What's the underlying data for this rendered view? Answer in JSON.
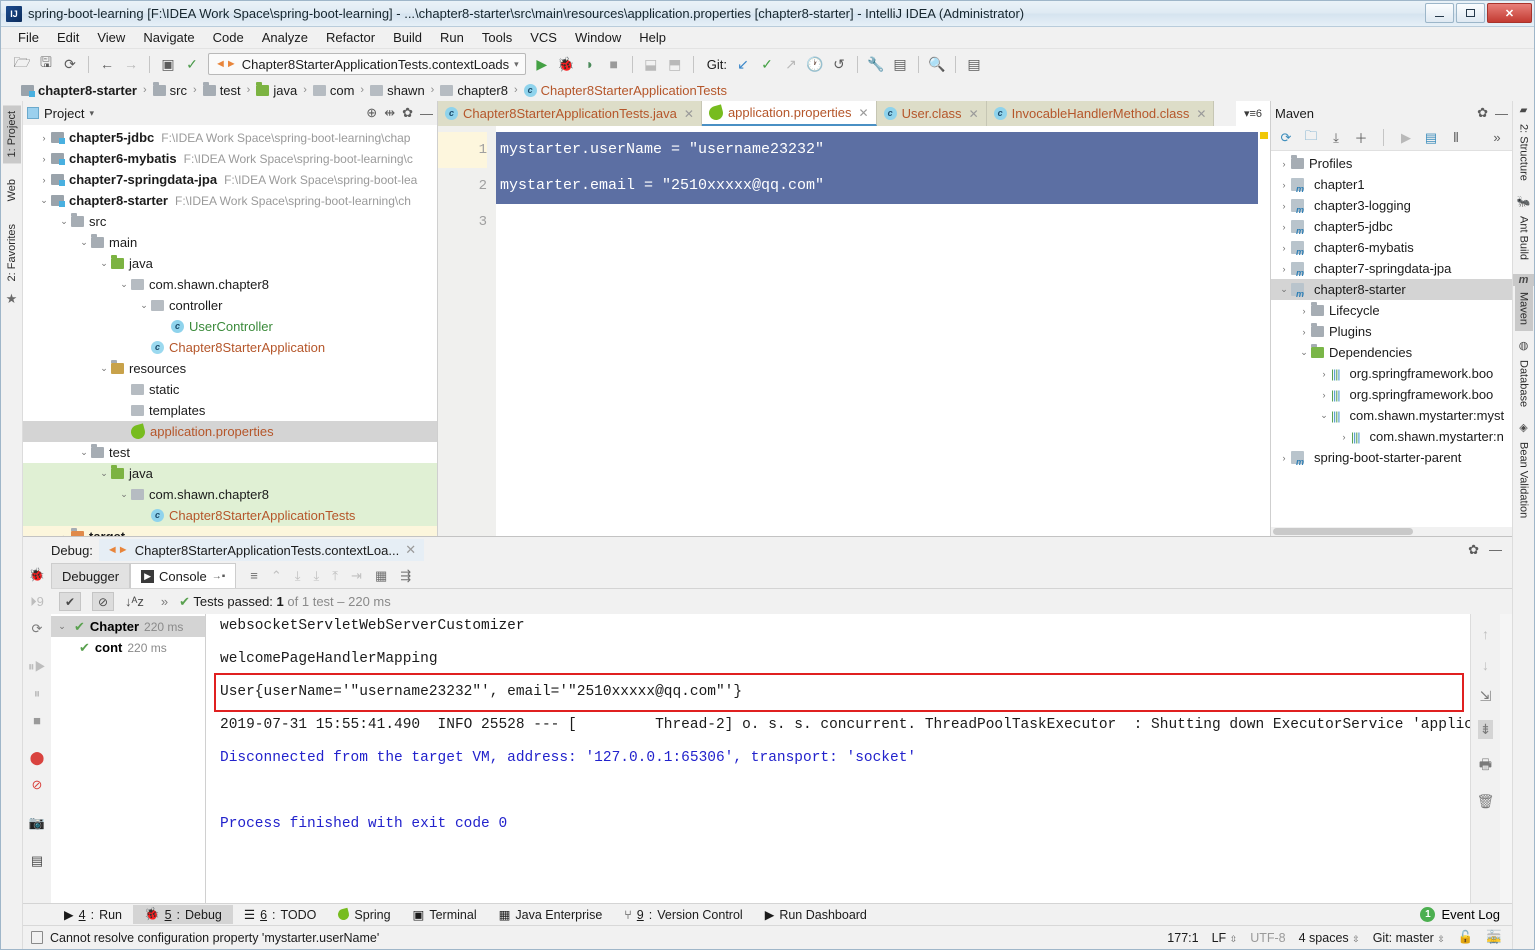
{
  "window": {
    "title": "spring-boot-learning [F:\\IDEA Work Space\\spring-boot-learning] - ...\\chapter8-starter\\src\\main\\resources\\application.properties [chapter8-starter] - IntelliJ IDEA (Administrator)",
    "logo": "IJ",
    "minimize_label": "minimize-icon",
    "maximize_label": "maximize-icon",
    "close_label": "✕"
  },
  "menubar": [
    "File",
    "Edit",
    "View",
    "Navigate",
    "Code",
    "Analyze",
    "Refactor",
    "Build",
    "Run",
    "Tools",
    "VCS",
    "Window",
    "Help"
  ],
  "toolbar": {
    "icons": [
      "open-folder-icon",
      "save-all-icon",
      "sync-icon",
      "back-icon",
      "forward-icon",
      "run-config-icon",
      "build-icon"
    ],
    "run_config": "Chapter8StarterApplicationTests.contextLoads",
    "run_config_caret": "▾",
    "run_icons": [
      "run-icon",
      "debug-icon",
      "run-coverage-icon",
      "stop-icon"
    ],
    "profile_icons": [
      "attach-profiler-icon",
      "profiler-icon"
    ],
    "git_label": "Git:",
    "git_icons": [
      "update-project-icon",
      "commit-icon",
      "push-icon",
      "history-icon",
      "rollback-icon"
    ],
    "tail_icons": [
      "settings-wrench-icon",
      "project-structure-icon",
      "search-icon",
      "stack-icon"
    ]
  },
  "breadcrumbs": [
    {
      "label": "chapter8-starter",
      "type": "module",
      "bold": true
    },
    {
      "label": "src",
      "type": "folder"
    },
    {
      "label": "test",
      "type": "folder"
    },
    {
      "label": "java",
      "type": "source-folder"
    },
    {
      "label": "com",
      "type": "package"
    },
    {
      "label": "shawn",
      "type": "package"
    },
    {
      "label": "chapter8",
      "type": "package"
    },
    {
      "label": "Chapter8StarterApplicationTests",
      "type": "class",
      "orange": true
    }
  ],
  "left_stripe": [
    {
      "label": "1: Project",
      "active": true
    },
    {
      "label": "Web",
      "icon": "web-icon"
    },
    {
      "label": "2: Favorites",
      "icon": "star-icon"
    }
  ],
  "right_stripe": [
    {
      "label": "2: Structure",
      "icon": "structure-icon"
    },
    {
      "label": "Ant Build",
      "icon": "ant-icon"
    },
    {
      "label": "Maven",
      "icon": "maven-icon",
      "active": true
    },
    {
      "label": "Database",
      "icon": "database-icon"
    },
    {
      "label": "Bean Validation",
      "icon": "bean-icon"
    }
  ],
  "project_panel": {
    "title": "Project",
    "title_caret": "▾",
    "actions": [
      "locate-icon",
      "collapse-all-icon",
      "settings-gear-icon",
      "hide-icon"
    ],
    "tree": [
      {
        "indent": 0,
        "arrow": "›",
        "label": "chapter5-jdbc",
        "bold": true,
        "icon": "module",
        "path": "F:\\IDEA Work Space\\spring-boot-learning\\chap"
      },
      {
        "indent": 0,
        "arrow": "›",
        "label": "chapter6-mybatis",
        "bold": true,
        "icon": "module",
        "path": "F:\\IDEA Work Space\\spring-boot-learning\\c"
      },
      {
        "indent": 0,
        "arrow": "›",
        "label": "chapter7-springdata-jpa",
        "bold": true,
        "icon": "module",
        "path": "F:\\IDEA Work Space\\spring-boot-lea"
      },
      {
        "indent": 0,
        "arrow": "⌄",
        "label": "chapter8-starter",
        "bold": true,
        "icon": "module",
        "path": "F:\\IDEA Work Space\\spring-boot-learning\\ch"
      },
      {
        "indent": 1,
        "arrow": "⌄",
        "label": "src",
        "icon": "folder"
      },
      {
        "indent": 2,
        "arrow": "⌄",
        "label": "main",
        "icon": "folder"
      },
      {
        "indent": 3,
        "arrow": "⌄",
        "label": "java",
        "icon": "source-folder"
      },
      {
        "indent": 4,
        "arrow": "⌄",
        "label": "com.shawn.chapter8",
        "icon": "package"
      },
      {
        "indent": 5,
        "arrow": "⌄",
        "label": "controller",
        "icon": "package"
      },
      {
        "indent": 6,
        "arrow": "",
        "label": "UserController",
        "icon": "class",
        "green": true
      },
      {
        "indent": 5,
        "arrow": "",
        "label": "Chapter8StarterApplication",
        "icon": "spring-class",
        "orange": true
      },
      {
        "indent": 3,
        "arrow": "⌄",
        "label": "resources",
        "icon": "resource-folder"
      },
      {
        "indent": 4,
        "arrow": "",
        "label": "static",
        "icon": "package"
      },
      {
        "indent": 4,
        "arrow": "",
        "label": "templates",
        "icon": "package"
      },
      {
        "indent": 4,
        "arrow": "",
        "label": "application.properties",
        "icon": "spring-leaf",
        "orange": true,
        "sel": "gray"
      },
      {
        "indent": 2,
        "arrow": "⌄",
        "label": "test",
        "icon": "folder"
      },
      {
        "indent": 3,
        "arrow": "⌄",
        "label": "java",
        "icon": "source-folder",
        "sel": "green"
      },
      {
        "indent": 4,
        "arrow": "⌄",
        "label": "com.shawn.chapter8",
        "icon": "package",
        "sel": "green"
      },
      {
        "indent": 5,
        "arrow": "",
        "label": "Chapter8StarterApplicationTests",
        "icon": "test-class",
        "orange": true,
        "sel": "green"
      },
      {
        "indent": 1,
        "arrow": "›",
        "label": "target",
        "bold": true,
        "icon": "target-folder",
        "sel": "yellow"
      }
    ]
  },
  "editor": {
    "tabs": [
      {
        "label": "Chapter8StarterApplicationTests.java",
        "icon": "test-class-icon",
        "active": false,
        "close": "✕"
      },
      {
        "label": "application.properties",
        "icon": "spring-leaf-icon",
        "active": true,
        "close": "✕"
      },
      {
        "label": "User.class",
        "icon": "class-icon",
        "active": false,
        "close": "✕"
      },
      {
        "label": "InvocableHandlerMethod.class",
        "icon": "class-icon",
        "active": false,
        "close": "✕"
      }
    ],
    "tab_overflow": "▾≡6",
    "line_numbers": [
      "1",
      "2",
      "3"
    ],
    "lines": [
      "mystarter.userName = \"username23232\"",
      "mystarter.email = \"2510xxxxx@qq.com\"",
      ""
    ]
  },
  "maven_panel": {
    "title": "Maven",
    "header_actions": [
      "settings-gear-icon",
      "hide-icon"
    ],
    "toolbar_icons": [
      "reimport-icon",
      "generate-sources-icon",
      "download-sources-icon",
      "add-icon",
      "run-icon",
      "toggle-offline-icon",
      "skip-tests-icon",
      "more-icon"
    ],
    "tree": [
      {
        "indent": 0,
        "arrow": "›",
        "label": "Profiles",
        "icon": "profiles-icon"
      },
      {
        "indent": 0,
        "arrow": "›",
        "label": "chapter1",
        "icon": "maven-icon"
      },
      {
        "indent": 0,
        "arrow": "›",
        "label": "chapter3-logging",
        "icon": "maven-icon"
      },
      {
        "indent": 0,
        "arrow": "›",
        "label": "chapter5-jdbc",
        "icon": "maven-icon"
      },
      {
        "indent": 0,
        "arrow": "›",
        "label": "chapter6-mybatis",
        "icon": "maven-icon"
      },
      {
        "indent": 0,
        "arrow": "›",
        "label": "chapter7-springdata-jpa",
        "icon": "maven-icon"
      },
      {
        "indent": 0,
        "arrow": "⌄",
        "label": "chapter8-starter",
        "icon": "maven-icon",
        "sel": true
      },
      {
        "indent": 1,
        "arrow": "›",
        "label": "Lifecycle",
        "icon": "lifecycle-icon"
      },
      {
        "indent": 1,
        "arrow": "›",
        "label": "Plugins",
        "icon": "plugins-icon"
      },
      {
        "indent": 1,
        "arrow": "⌄",
        "label": "Dependencies",
        "icon": "dependencies-icon"
      },
      {
        "indent": 2,
        "arrow": "›",
        "label": "org.springframework.boo",
        "icon": "dep-icon"
      },
      {
        "indent": 2,
        "arrow": "›",
        "label": "org.springframework.boo",
        "icon": "dep-icon"
      },
      {
        "indent": 2,
        "arrow": "⌄",
        "label": "com.shawn.mystarter:myst",
        "icon": "dep-icon"
      },
      {
        "indent": 3,
        "arrow": "›",
        "label": "com.shawn.mystarter:n",
        "icon": "dep-icon"
      },
      {
        "indent": 0,
        "arrow": "›",
        "label": "spring-boot-starter-parent",
        "icon": "maven-icon"
      }
    ]
  },
  "debug_panel": {
    "header_label": "Debug:",
    "session_tab": "Chapter8StarterApplicationTests.contextLoa...",
    "session_close": "✕",
    "header_actions": [
      "settings-gear-icon",
      "hide-icon"
    ],
    "tabs": [
      {
        "label": "Debugger",
        "active": false
      },
      {
        "label": "Console",
        "active": true,
        "icon": "console-icon",
        "pin": "→▪"
      }
    ],
    "tab_tool_icons": [
      "layout-icon",
      "restore-layout-icon",
      "step-over-icon",
      "step-into-icon",
      "step-out-icon",
      "run-to-cursor-icon",
      "evaluate-icon",
      "settings-icon"
    ],
    "rail_icons": [
      "debug-bug-icon",
      "rerun-icon",
      "rerun-failed-icon",
      "resume-icon",
      "pause-icon",
      "stop-icon",
      "breakpoints-icon",
      "mute-breakpoints-icon",
      "screenshot-icon",
      "layout-settings-icon",
      "more-icon"
    ],
    "test_toolbar": {
      "icons": [
        "show-passed-icon",
        "hide-ignored-icon",
        "sort-alpha-icon",
        "more-icon"
      ],
      "status_check": "✔",
      "status_label": "Tests passed:",
      "status_count": "1",
      "status_detail": "of 1 test – 220 ms"
    },
    "test_tree": [
      {
        "indent": 0,
        "arrow": "⌄",
        "check": "✔",
        "label": "Chapter",
        "time": "220 ms"
      },
      {
        "indent": 1,
        "arrow": "",
        "check": "✔",
        "label": "cont",
        "time": "220 ms"
      }
    ],
    "console_lines": [
      {
        "text": "websocketServletWebServerCustomizer",
        "color": "black"
      },
      {
        "text": "",
        "color": "black"
      },
      {
        "text": "welcomePageHandlerMapping",
        "color": "black"
      },
      {
        "text": "",
        "color": "black"
      },
      {
        "text": "User{userName='\"username23232\"', email='\"2510xxxxx@qq.com\"'}",
        "color": "black",
        "boxed": true
      },
      {
        "text": "2019-07-31 15:55:41.490  INFO 25528 --- [         Thread-2] o. s. s. concurrent. ThreadPoolTaskExecutor  : Shutting down ExecutorService 'applicatio",
        "color": "black"
      },
      {
        "text": "Disconnected from the target VM, address: '127.0.0.1:65306', transport: 'socket'",
        "color": "blue"
      },
      {
        "text": "",
        "color": "black"
      },
      {
        "text": "Process finished with exit code 0",
        "color": "blue"
      }
    ],
    "console_rail_icons": [
      "scroll-up-icon",
      "scroll-down-icon",
      "soft-wrap-icon",
      "scroll-to-end-icon",
      "print-icon",
      "clear-all-icon"
    ]
  },
  "toolwindow_bar": {
    "items": [
      {
        "num": "4",
        "label": "Run",
        "icon": "run-icon"
      },
      {
        "num": "5",
        "label": "Debug",
        "icon": "debug-icon",
        "active": true
      },
      {
        "num": "6",
        "label": "TODO",
        "icon": "todo-icon"
      },
      {
        "num": "",
        "label": "Spring",
        "icon": "spring-icon"
      },
      {
        "num": "",
        "label": "Terminal",
        "icon": "terminal-icon"
      },
      {
        "num": "",
        "label": "Java Enterprise",
        "icon": "java-enterprise-icon"
      },
      {
        "num": "9",
        "label": "Version Control",
        "icon": "vcs-icon"
      },
      {
        "num": "",
        "label": "Run Dashboard",
        "icon": "run-dashboard-icon"
      }
    ],
    "event_log": "Event Log",
    "event_log_count": "1"
  },
  "statusbar": {
    "message": "Cannot resolve configuration property 'mystarter.userName'",
    "message_icon": "inspection-icon",
    "position": "177:1",
    "line_separator": "LF",
    "encoding": "UTF-8",
    "indent": "4 spaces",
    "git_branch": "Git: master",
    "caret": "⌃",
    "lock_icon": "lock-icon",
    "train_icon": "ide-train-icon"
  }
}
